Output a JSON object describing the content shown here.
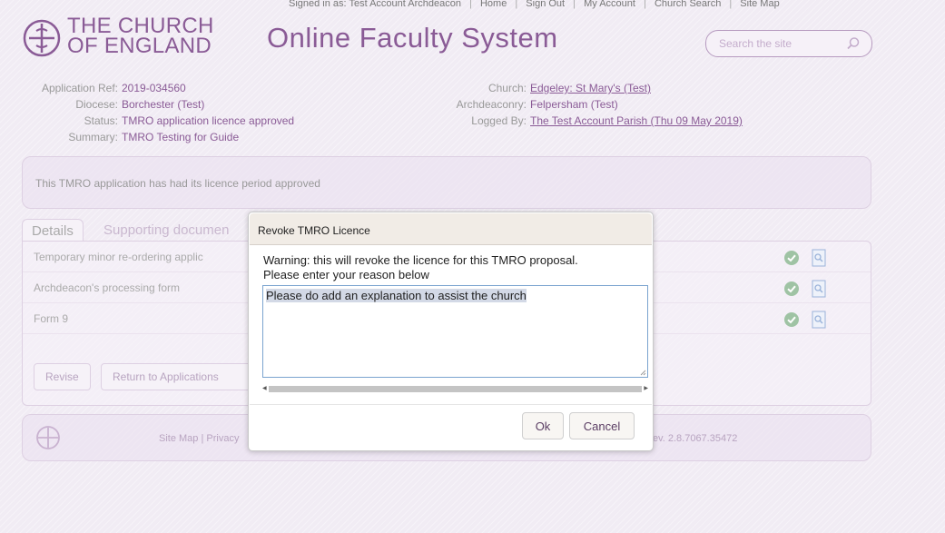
{
  "top_nav": {
    "signed_in": "Signed in as: Test Account Archdeacon",
    "links": [
      "Home",
      "Sign Out",
      "My Account",
      "Church Search",
      "Site Map"
    ]
  },
  "header": {
    "logo_line1": "THE CHURCH",
    "logo_line2": "OF ENGLAND",
    "site_title": "Online Faculty System",
    "search_placeholder": "Search the site"
  },
  "application": {
    "left": [
      {
        "label": "Application Ref:",
        "value": "2019-034560",
        "link": false
      },
      {
        "label": "Diocese:",
        "value": "Borchester (Test)",
        "link": false
      },
      {
        "label": "Status:",
        "value": "TMRO application licence approved",
        "link": false
      },
      {
        "label": "Summary:",
        "value": "TMRO Testing for Guide",
        "link": false
      }
    ],
    "right": [
      {
        "label": "Church:",
        "value": "Edgeley: St Mary's (Test)",
        "link": true
      },
      {
        "label": "Archdeaconry:",
        "value": "Felpersham (Test)",
        "link": false
      },
      {
        "label": "Logged By:",
        "value": "The Test Account Parish (Thu 09 May 2019)",
        "link": true
      }
    ]
  },
  "status_message": "This TMRO application has had its licence period approved",
  "tabs": [
    "Details",
    "Supporting documen"
  ],
  "forms": [
    "Temporary minor re-ordering applic",
    "Archdeacon's processing form",
    "Form 9"
  ],
  "actions": {
    "revise": "Revise",
    "return": "Return to Applications"
  },
  "footer": {
    "links": "Site Map | Privacy",
    "revision": "Rev. 2.8.7067.35472"
  },
  "dialog": {
    "title": "Revoke TMRO Licence",
    "warning_line1": "Warning: this will revoke the licence for this TMRO proposal.",
    "warning_line2": "Please enter your reason below",
    "reason_value": "Please do add an explanation to assist the church",
    "ok_label": "Ok",
    "cancel_label": "Cancel"
  },
  "colors": {
    "brand": "#8a5b96",
    "overlay": "#f1ecf4",
    "dialog_header": "#f1ece6",
    "textarea_border": "#7ba4cf"
  },
  "icons": {
    "approved": "check-circle-icon",
    "view": "document-view-icon",
    "search": "search-icon",
    "logo": "church-cross-logo-icon"
  }
}
